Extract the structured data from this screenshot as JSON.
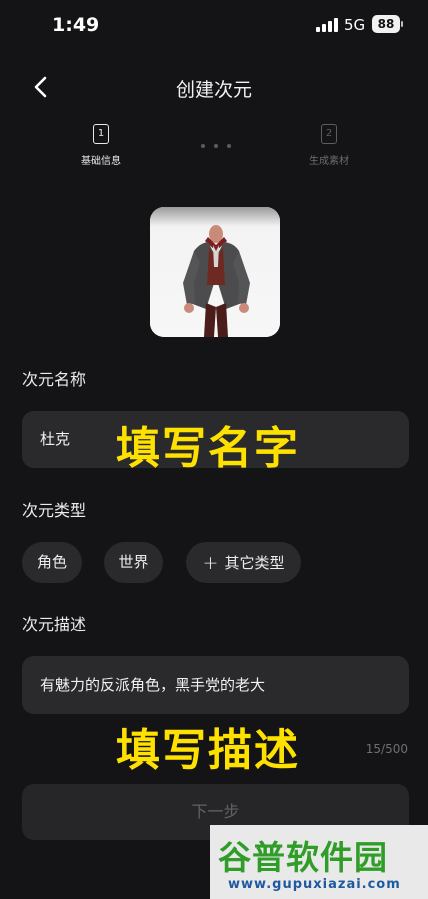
{
  "status_bar": {
    "time": "1:49",
    "network": "5G",
    "battery": "88"
  },
  "header": {
    "title": "创建次元"
  },
  "steps": [
    {
      "number": "1",
      "label": "基础信息",
      "active": true
    },
    {
      "number": "2",
      "label": "生成素材",
      "active": false
    }
  ],
  "form": {
    "name_label": "次元名称",
    "name_value": "杜克",
    "type_label": "次元类型",
    "type_options": [
      {
        "label": "角色"
      },
      {
        "label": "世界"
      },
      {
        "label": "其它类型"
      }
    ],
    "desc_label": "次元描述",
    "desc_value": "有魅力的反派角色，黑手党的老大",
    "desc_counter": "15/500"
  },
  "overlays": {
    "name_hint": "填写名字",
    "desc_hint": "填写描述"
  },
  "next_button": {
    "label": "下一步"
  },
  "watermark": {
    "logo": "谷普软件园",
    "url": "www.gupuxiazai.com"
  },
  "colors": {
    "background": "#141416",
    "field": "#2a2a2d",
    "overlay_text": "#ffe100",
    "watermark_green": "#2f9d28"
  }
}
